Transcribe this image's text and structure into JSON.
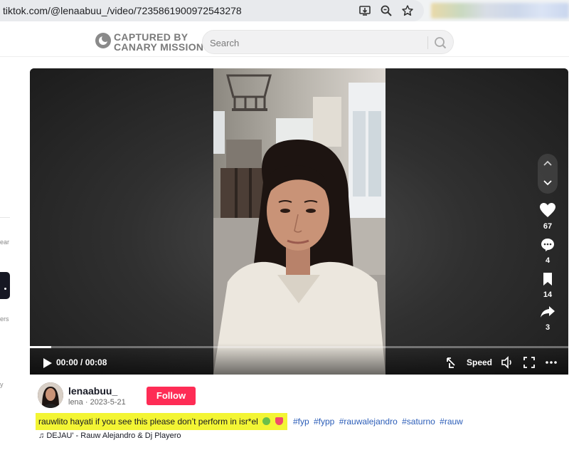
{
  "browser": {
    "url": "tiktok.com/@lenaabuu_/video/7235861900972543278",
    "icons": [
      "install-app-icon",
      "zoom-icon",
      "bookmark-star-icon"
    ]
  },
  "header": {
    "logo_line1": "CAPTURED BY",
    "logo_line2": "CANARY MISSION",
    "search_placeholder": "Search",
    "search_icon": "search-icon"
  },
  "sidebar": {
    "fragments": [
      "ear",
      "ers",
      "y"
    ]
  },
  "player": {
    "time": "00:00 / 00:08",
    "speed_label": "Speed",
    "progress_fraction": 0.04,
    "icons": [
      "play-icon",
      "float-icon",
      "volume-icon",
      "fullscreen-icon",
      "more-icon"
    ]
  },
  "actions": [
    {
      "icon": "heart-icon",
      "count": "67"
    },
    {
      "icon": "comment-icon",
      "count": "4"
    },
    {
      "icon": "bookmark-icon",
      "count": "14"
    },
    {
      "icon": "share-icon",
      "count": "3"
    }
  ],
  "author": {
    "username": "lenaabuu_",
    "subline": "lena · 2023-5-21",
    "follow_label": "Follow"
  },
  "caption": {
    "text": "rauwlito hayati if you see this please don’t perform in isr*el",
    "hashtags": [
      "#fyp",
      "#fypp",
      "#rauwalejandro",
      "#saturno",
      "#rauw"
    ]
  },
  "music": {
    "label": "DEJAU' - Rauw Alejandro & Dj Playero"
  },
  "colors": {
    "follow": "#fe2c55",
    "highlight": "#f3f534",
    "hashtag": "#2b5db8"
  }
}
